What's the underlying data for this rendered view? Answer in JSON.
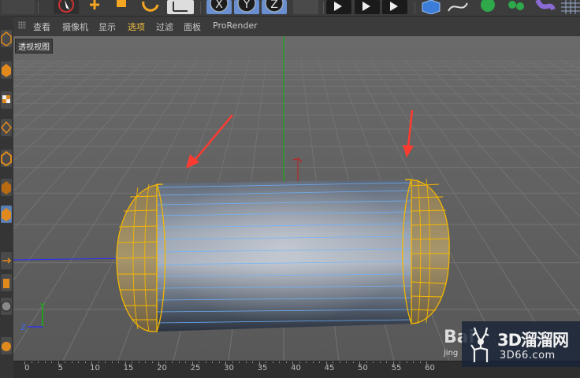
{
  "toolbar": {
    "buttons": [
      "undo-icon",
      "select-icon",
      "move-icon",
      "scale-icon",
      "rotate-icon",
      "coordinate-icon",
      "x-axis-icon",
      "y-axis-icon",
      "z-axis-icon",
      "render-view-icon",
      "render-picture-icon",
      "render-settings-icon",
      "cube-icon",
      "spline-icon",
      "subdivision-icon",
      "array-icon",
      "deformer-icon",
      "floor-icon"
    ],
    "axis_x": "X",
    "axis_y": "Y",
    "axis_z": "Z"
  },
  "sidebar": {
    "tools": [
      "model-mode-icon",
      "texture-mode-icon",
      "checker-icon",
      "points-mode-icon",
      "edges-mode-icon",
      "polygons-mode-icon",
      "object-mode-icon",
      "move-handle-icon",
      "solo-icon",
      "snap-icon",
      "lock-icon"
    ]
  },
  "viewport_menu": {
    "items": [
      {
        "label": "查看",
        "active": false
      },
      {
        "label": "摄像机",
        "active": false
      },
      {
        "label": "显示",
        "active": false
      },
      {
        "label": "选项",
        "active": true
      },
      {
        "label": "过滤",
        "active": false
      },
      {
        "label": "面板",
        "active": false
      },
      {
        "label": "ProRender",
        "active": false
      }
    ]
  },
  "viewport": {
    "label": "透视视图",
    "gizmo": {
      "y": "Y",
      "z": "Z"
    },
    "colors": {
      "background": "#5e5e5e",
      "grid": "#6e6e6e",
      "selection": "#f5b800",
      "x_axis": "#2929ff",
      "y_axis": "#00c800",
      "annotation_arrow": "#ff3b30"
    }
  },
  "timeline": {
    "ticks": [
      "0",
      "5",
      "10",
      "15",
      "20",
      "25",
      "30",
      "35",
      "40",
      "45",
      "50",
      "55",
      "60"
    ]
  },
  "watermark": {
    "brand": "3D溜溜网",
    "url": "3D66.com",
    "baidu": "Bai",
    "jingyan": "jing"
  }
}
